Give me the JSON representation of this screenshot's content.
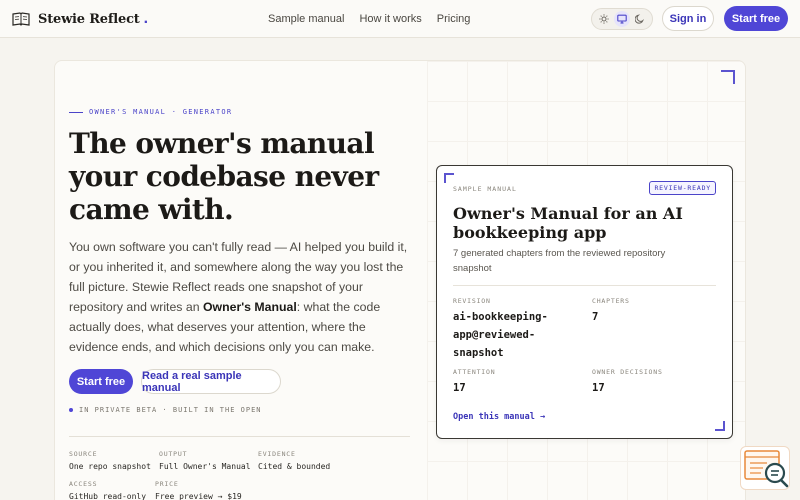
{
  "header": {
    "brand": "Stewie Reflect",
    "brand_suffix": ".",
    "nav": [
      "Sample manual",
      "How it works",
      "Pricing"
    ],
    "sign_in": "Sign in",
    "start_free": "Start free"
  },
  "hero": {
    "eyebrow": "OWNER'S MANUAL · GENERATOR",
    "headline": "The owner's manual your codebase never came with.",
    "lede_1": "You own software you can't fully read — AI helped you build it, or you inherited it, and somewhere along the way you lost the full picture. Stewie Reflect reads one snapshot of your repository and writes an ",
    "lede_bold": "Owner's Manual",
    "lede_2": ": what the code actually does, what deserves your attention, where the evidence ends, and which decisions only you can make.",
    "cta_primary": "Start free",
    "cta_secondary": "Read a real sample manual",
    "beta_note": "IN PRIVATE BETA · BUILT IN THE OPEN",
    "facts": [
      {
        "key": "SOURCE",
        "value": "One repo snapshot"
      },
      {
        "key": "OUTPUT",
        "value": "Full Owner's Manual"
      },
      {
        "key": "EVIDENCE",
        "value": "Cited & bounded"
      },
      {
        "key": "ACCESS",
        "value": "GitHub read-only"
      },
      {
        "key": "PRICE",
        "value": "Free preview → $19"
      }
    ]
  },
  "card": {
    "label": "SAMPLE MANUAL",
    "badge": "REVIEW-READY",
    "title": "Owner's Manual for an AI bookkeeping app",
    "subtitle": "7 generated chapters from the reviewed repository snapshot",
    "revision_key": "REVISION",
    "revision_value": "ai-bookkeeping-app@reviewed-snapshot",
    "chapters_key": "CHAPTERS",
    "chapters_value": "7",
    "attention_key": "ATTENTION",
    "attention_value": "17",
    "decisions_key": "OWNER DECISIONS",
    "decisions_value": "17",
    "open_link": "Open this manual →"
  },
  "colors": {
    "accent": "#4f46d6",
    "background": "#f6f4ef",
    "text": "#1c1a17"
  }
}
